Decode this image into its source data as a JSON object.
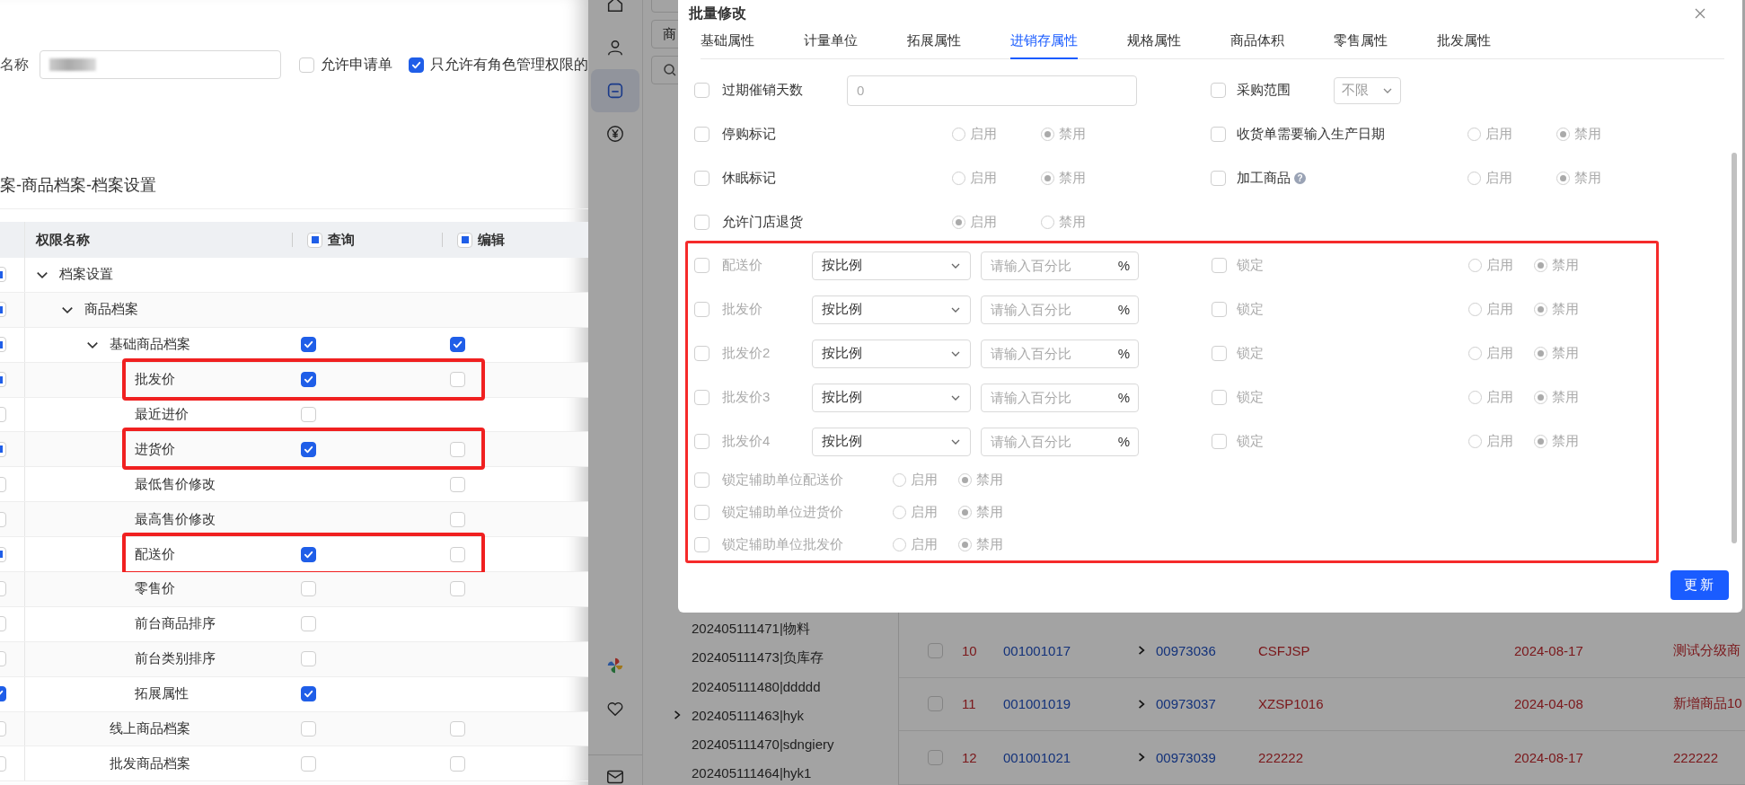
{
  "left_page": {
    "name_label": "名称",
    "name_field": {
      "redacted": true
    },
    "options": [
      {
        "label": "允许申请单",
        "checked": false
      },
      {
        "label": "只允许有角色管理权限的",
        "checked": true
      }
    ],
    "section_title": "案-商品档案-档案设置",
    "table": {
      "columns": [
        {
          "label": "权限名称"
        },
        {
          "label": "查询",
          "indeterminate": true
        },
        {
          "label": "编辑",
          "indeterminate": true
        }
      ],
      "rows": [
        {
          "label": "档案设置",
          "expanded": true,
          "select": {
            "indeterminate": true
          },
          "highlighted": false,
          "children": [
            {
              "label": "商品档案",
              "expanded": true,
              "select": {
                "indeterminate": true
              },
              "highlighted": false,
              "children": [
                {
                  "label": "基础商品档案",
                  "expanded": true,
                  "select": {
                    "indeterminate": true
                  },
                  "query": {
                    "checked": true
                  },
                  "edit": {
                    "checked": true
                  },
                  "highlighted": false,
                  "children": [
                    {
                      "label": "批发价",
                      "select": {
                        "indeterminate": true
                      },
                      "query": {
                        "checked": true
                      },
                      "edit": {
                        "checked": false
                      },
                      "highlighted": true
                    },
                    {
                      "label": "最近进价",
                      "select": {
                        "checked": false,
                        "indeterminate": false
                      },
                      "query": {
                        "checked": false
                      },
                      "highlighted": false
                    },
                    {
                      "label": "进货价",
                      "select": {
                        "indeterminate": true
                      },
                      "query": {
                        "checked": true
                      },
                      "edit": {
                        "checked": false
                      },
                      "highlighted": true
                    },
                    {
                      "label": "最低售价修改",
                      "select": {
                        "checked": false,
                        "indeterminate": false
                      },
                      "edit": {
                        "checked": false
                      },
                      "highlighted": false
                    },
                    {
                      "label": "最高售价修改",
                      "select": {
                        "checked": false,
                        "indeterminate": false
                      },
                      "edit": {
                        "checked": false
                      },
                      "highlighted": false
                    },
                    {
                      "label": "配送价",
                      "select": {
                        "indeterminate": true
                      },
                      "query": {
                        "checked": true
                      },
                      "edit": {
                        "checked": false
                      },
                      "highlighted": true
                    },
                    {
                      "label": "零售价",
                      "select": {
                        "checked": false,
                        "indeterminate": false
                      },
                      "query": {
                        "checked": false
                      },
                      "edit": {
                        "checked": false
                      },
                      "highlighted": false
                    },
                    {
                      "label": "前台商品排序",
                      "select": {
                        "checked": false,
                        "indeterminate": false
                      },
                      "query": {
                        "checked": false
                      },
                      "highlighted": false
                    },
                    {
                      "label": "前台类别排序",
                      "select": {
                        "checked": false,
                        "indeterminate": false
                      },
                      "query": {
                        "checked": false
                      },
                      "highlighted": false
                    },
                    {
                      "label": "拓展属性",
                      "select": {
                        "checked": true,
                        "indeterminate": false
                      },
                      "query": {
                        "checked": true
                      },
                      "highlighted": false
                    }
                  ]
                },
                {
                  "label": "线上商品档案",
                  "select": {
                    "checked": false,
                    "indeterminate": false
                  },
                  "query": {
                    "checked": false
                  },
                  "edit": {
                    "checked": false
                  },
                  "highlighted": false
                },
                {
                  "label": "批发商品档案",
                  "select": {
                    "checked": false,
                    "indeterminate": false
                  },
                  "query": {
                    "checked": false
                  },
                  "edit": {
                    "checked": false
                  },
                  "highlighted": false
                }
              ]
            }
          ]
        }
      ]
    }
  },
  "app": {
    "sidebar": {
      "top": [
        {
          "kind": "home",
          "selected": false
        },
        {
          "kind": "user",
          "selected": false
        },
        {
          "kind": "box",
          "selected": true
        },
        {
          "kind": "yen",
          "selected": false
        }
      ],
      "bottom": [
        {
          "kind": "pinwheel",
          "selected": false
        },
        {
          "kind": "heart",
          "selected": false
        },
        {
          "kind": "mail",
          "selected": false
        }
      ]
    },
    "filter_field": {
      "value": "商"
    },
    "tree": [
      {
        "label": "202405111471|物料"
      },
      {
        "label": "202405111473|负库存"
      },
      {
        "label": "202405111480|ddddd"
      },
      {
        "label": "202405111463|hyk",
        "expanded": false
      },
      {
        "label": "202405111470|sdngiery"
      },
      {
        "label": "202405111464|hyk1"
      }
    ],
    "rows": [
      {
        "checked": false,
        "cells": [
          "10",
          "001001017",
          "00973036",
          "CSFJSP",
          "2024-08-17",
          "测试分级商"
        ]
      },
      {
        "checked": false,
        "cells": [
          "11",
          "001001019",
          "00973037",
          "XZSP1016",
          "2024-04-08",
          "新增商品10"
        ]
      },
      {
        "checked": false,
        "cells": [
          "12",
          "001001021",
          "00973039",
          "222222",
          "2024-08-17",
          "222222"
        ]
      }
    ]
  },
  "modal": {
    "title": "批量修改",
    "tabs": [
      {
        "label": "基础属性",
        "selected": false
      },
      {
        "label": "计量单位",
        "selected": false
      },
      {
        "label": "拓展属性",
        "selected": false
      },
      {
        "label": "进销存属性",
        "selected": true
      },
      {
        "label": "规格属性",
        "selected": false
      },
      {
        "label": "商品体积",
        "selected": false
      },
      {
        "label": "零售属性",
        "selected": false
      },
      {
        "label": "批发属性",
        "selected": false
      }
    ],
    "rows": [
      {
        "left": {
          "kind": "input",
          "label": "过期催销天数",
          "checked": false,
          "placeholder": "0"
        },
        "right": {
          "kind": "select",
          "label": "采购范围",
          "checked": false,
          "value": "不限"
        }
      },
      {
        "left": {
          "kind": "radio",
          "label": "停购标记",
          "checked": false,
          "options": [
            {
              "label": "启用",
              "selected": false
            },
            {
              "label": "禁用",
              "selected": true
            }
          ]
        },
        "right": {
          "kind": "radio",
          "label": "收货单需要输入生产日期",
          "checked": false,
          "options": [
            {
              "label": "启用",
              "selected": false
            },
            {
              "label": "禁用",
              "selected": true
            }
          ]
        }
      },
      {
        "left": {
          "kind": "radio",
          "label": "休眠标记",
          "checked": false,
          "options": [
            {
              "label": "启用",
              "selected": false
            },
            {
              "label": "禁用",
              "selected": true
            }
          ]
        },
        "right": {
          "kind": "radio",
          "label": "加工商品",
          "help": "?",
          "checked": false,
          "options": [
            {
              "label": "启用",
              "selected": false
            },
            {
              "label": "禁用",
              "selected": true
            }
          ]
        }
      },
      {
        "left": {
          "kind": "radio",
          "label": "允许门店退货",
          "checked": false,
          "options": [
            {
              "label": "启用",
              "selected": true
            },
            {
              "label": "禁用",
              "selected": false
            }
          ]
        }
      }
    ],
    "price_section": {
      "highlighted": true,
      "rows": [
        {
          "label": "配送价",
          "checked": false,
          "mode": "按比例",
          "placeholder": "请输入百分比",
          "unit": "%",
          "lock_label": "锁定",
          "lock_checked": false,
          "options": [
            {
              "label": "启用",
              "selected": false
            },
            {
              "label": "禁用",
              "selected": true
            }
          ]
        },
        {
          "label": "批发价",
          "checked": false,
          "mode": "按比例",
          "placeholder": "请输入百分比",
          "unit": "%",
          "lock_label": "锁定",
          "lock_checked": false,
          "options": [
            {
              "label": "启用",
              "selected": false
            },
            {
              "label": "禁用",
              "selected": true
            }
          ]
        },
        {
          "label": "批发价2",
          "checked": false,
          "mode": "按比例",
          "placeholder": "请输入百分比",
          "unit": "%",
          "lock_label": "锁定",
          "lock_checked": false,
          "options": [
            {
              "label": "启用",
              "selected": false
            },
            {
              "label": "禁用",
              "selected": true
            }
          ]
        },
        {
          "label": "批发价3",
          "checked": false,
          "mode": "按比例",
          "placeholder": "请输入百分比",
          "unit": "%",
          "lock_label": "锁定",
          "lock_checked": false,
          "options": [
            {
              "label": "启用",
              "selected": false
            },
            {
              "label": "禁用",
              "selected": true
            }
          ]
        },
        {
          "label": "批发价4",
          "checked": false,
          "mode": "按比例",
          "placeholder": "请输入百分比",
          "unit": "%",
          "lock_label": "锁定",
          "lock_checked": false,
          "options": [
            {
              "label": "启用",
              "selected": false
            },
            {
              "label": "禁用",
              "selected": true
            }
          ]
        }
      ],
      "aux_rows": [
        {
          "label": "锁定辅助单位配送价",
          "checked": false,
          "options": [
            {
              "label": "启用",
              "selected": false
            },
            {
              "label": "禁用",
              "selected": true
            }
          ]
        },
        {
          "label": "锁定辅助单位进货价",
          "checked": false,
          "options": [
            {
              "label": "启用",
              "selected": false
            },
            {
              "label": "禁用",
              "selected": true
            }
          ]
        },
        {
          "label": "锁定辅助单位批发价",
          "checked": false,
          "options": [
            {
              "label": "启用",
              "selected": false
            },
            {
              "label": "禁用",
              "selected": true
            }
          ]
        }
      ]
    },
    "button": "更新"
  }
}
